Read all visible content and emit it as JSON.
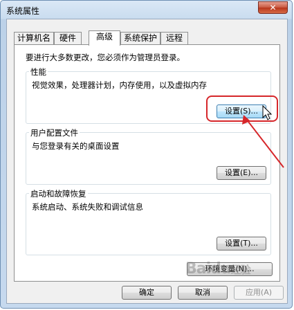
{
  "window": {
    "title": "系统属性",
    "close_glyph": "✕"
  },
  "tabs": [
    {
      "label": "计算机名"
    },
    {
      "label": "硬件"
    },
    {
      "label": "高级"
    },
    {
      "label": "系统保护"
    },
    {
      "label": "远程"
    }
  ],
  "notice": "要进行大多数更改，您必须作为管理员登录。",
  "performance": {
    "title": "性能",
    "desc": "视觉效果，处理器计划，内存使用，以及虚拟内存",
    "button": "设置(S)..."
  },
  "profile": {
    "title": "用户配置文件",
    "desc": "与您登录有关的桌面设置",
    "button": "设置(E)..."
  },
  "startup": {
    "title": "启动和故障恢复",
    "desc": "系统启动、系统失败和调试信息",
    "button": "设置(T)..."
  },
  "env_button": "环境变量(N)...",
  "footer": {
    "ok": "确定",
    "cancel": "取消",
    "apply": "应用(A)"
  },
  "watermark": {
    "brand": "Baidu",
    "sub": "经验"
  },
  "colors": {
    "highlight": "#d6262a",
    "accent": "#3c7fb1"
  }
}
